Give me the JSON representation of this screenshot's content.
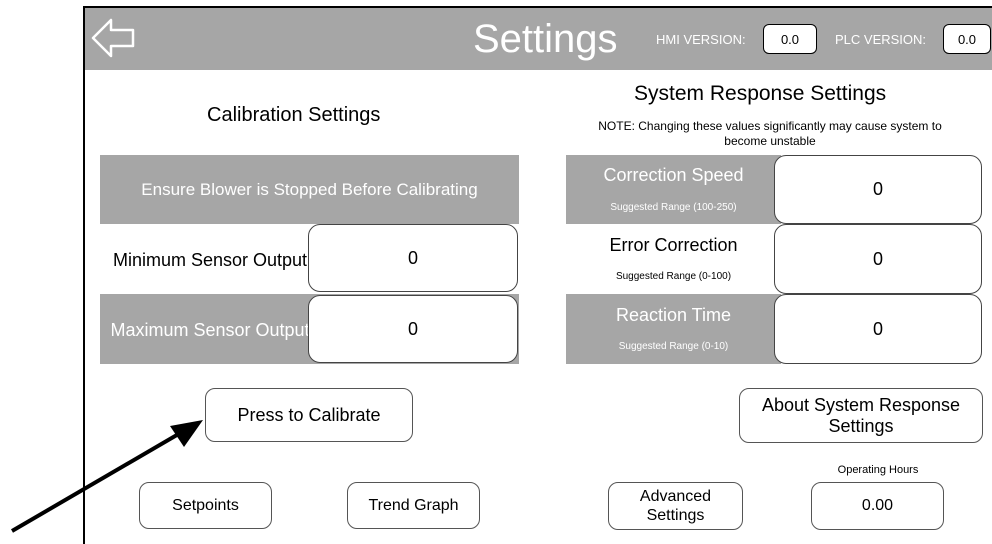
{
  "header": {
    "title": "Settings",
    "hmi_version_label": "HMI VERSION:",
    "hmi_version_value": "0.0",
    "plc_version_label": "PLC VERSION:",
    "plc_version_value": "0.0"
  },
  "calibration": {
    "heading": "Calibration Settings",
    "warning": "Ensure Blower is Stopped Before Calibrating",
    "min_label": "Minimum Sensor Output",
    "min_value": "0",
    "max_label": "Maximum Sensor Output",
    "max_value": "0",
    "calibrate_button": "Press to Calibrate"
  },
  "system_response": {
    "heading": "System Response Settings",
    "note": "NOTE: Changing these values significantly may cause system to become unstable",
    "correction_speed_label": "Correction Speed",
    "correction_speed_range": "Suggested Range (100-250)",
    "correction_speed_value": "0",
    "error_correction_label": "Error Correction",
    "error_correction_range": "Suggested Range (0-100)",
    "error_correction_value": "0",
    "reaction_time_label": "Reaction Time",
    "reaction_time_range": "Suggested Range (0-10)",
    "reaction_time_value": "0",
    "about_button": "About System Response Settings"
  },
  "footer": {
    "setpoints_button": "Setpoints",
    "trend_graph_button": "Trend Graph",
    "advanced_settings_button": "Advanced Settings",
    "operating_hours_label": "Operating Hours",
    "operating_hours_value": "0.00"
  },
  "colors": {
    "header_grey": "#a6a6a6",
    "panel_grey": "#a6a6a6",
    "text_white": "#ffffff"
  }
}
